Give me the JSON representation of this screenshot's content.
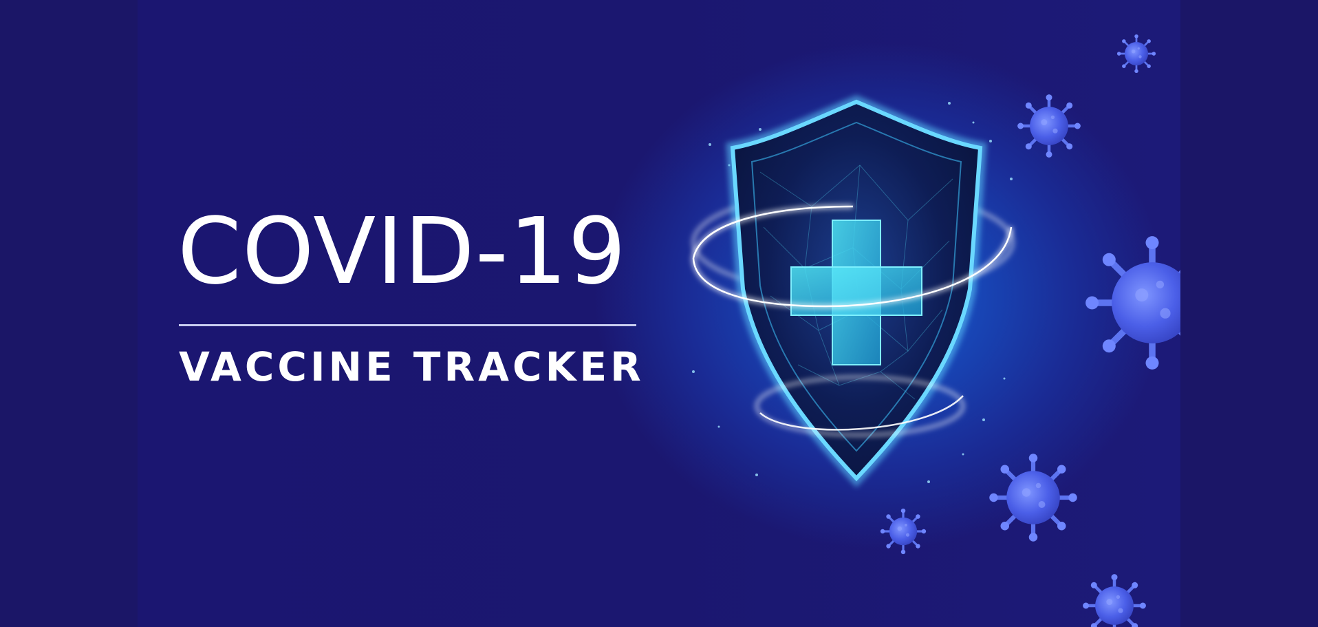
{
  "banner": {
    "title": "COVID-19",
    "subtitle": "VACCINE TRACKER"
  },
  "colors": {
    "outer_background": "#1b1667",
    "banner_background": "#1b1770",
    "glow": "#1c5fd6",
    "shield_edge": "#5fd0ff",
    "cross": "#35d7f0",
    "virus": "#5a78f2",
    "text": "#ffffff"
  },
  "icons": [
    "shield-icon",
    "medical-cross-icon",
    "virus-icon"
  ]
}
